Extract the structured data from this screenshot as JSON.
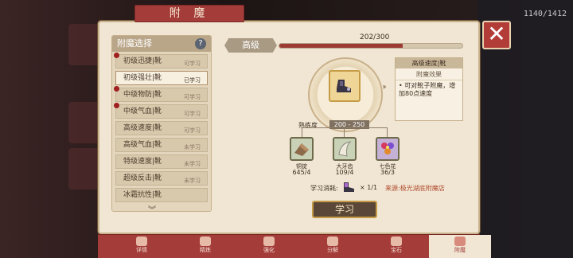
{
  "title": "附  魔",
  "background": {
    "counter": "1140/1412"
  },
  "list": {
    "header": "附魔选择",
    "help": "?",
    "items": [
      {
        "name": "初级迅捷|靴",
        "status": "可学习",
        "dot": true
      },
      {
        "name": "初级强壮|靴",
        "status": "已学习",
        "dot": false
      },
      {
        "name": "中级物防|靴",
        "status": "可学习",
        "dot": true
      },
      {
        "name": "中级气血|靴",
        "status": "可学习",
        "dot": true
      },
      {
        "name": "高级速度|靴",
        "status": "可学习",
        "dot": false
      },
      {
        "name": "高级气血|靴",
        "status": "未学习",
        "dot": false
      },
      {
        "name": "特级速度|靴",
        "status": "未学习",
        "dot": false
      },
      {
        "name": "超级反击|靴",
        "status": "未学习",
        "dot": false
      },
      {
        "name": "冰霜抗性|靴",
        "status": "",
        "dot": false
      }
    ],
    "selected_index": 1,
    "scroll_arrow": "︾"
  },
  "level": {
    "label": "高级",
    "count": "202/300",
    "progress": 0.673
  },
  "detail": {
    "card_title": "高级速度|靴",
    "effect_header": "附魔效果",
    "effect_text": "• 可对靴子附魔，增加80点速度",
    "chevrons": "›››"
  },
  "proficiency": {
    "label": "熟练度",
    "range": "200 - 250"
  },
  "materials": [
    {
      "name": "铜锭",
      "count": "645/4",
      "color": "#c9d2b6"
    },
    {
      "name": "大牙齿",
      "count": "109/4",
      "color": "#c9d2b6"
    },
    {
      "name": "七色花",
      "count": "36/3",
      "color": "#c5b0d6"
    }
  ],
  "cost": {
    "label": "学习消耗:",
    "count": "× 1/1",
    "source": "来源:极光湖底附魔店"
  },
  "learn_button": "学习",
  "close": "✕",
  "tabs": [
    "详情",
    "精炼",
    "强化",
    "分解",
    "宝石",
    "附魔"
  ],
  "active_tab": 5,
  "colors": {
    "accent": "#a43d3a",
    "panel": "#f0e6d3",
    "button": "#5a4737"
  }
}
